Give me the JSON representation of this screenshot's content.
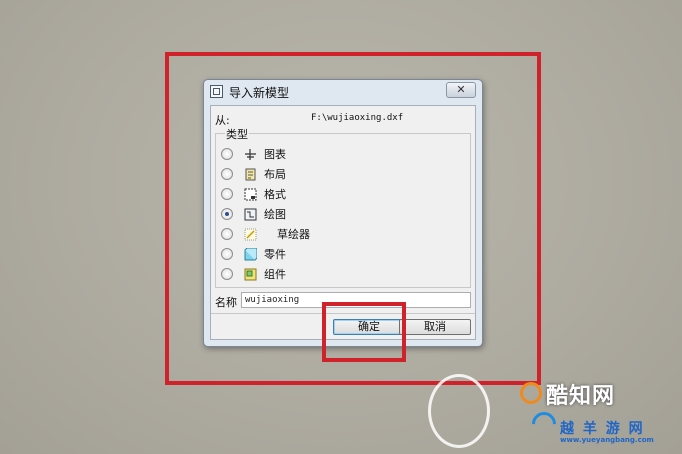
{
  "dialog": {
    "title": "导入新模型",
    "close_label": "✕",
    "from_label": "从:",
    "from_value": "F:\\wujiaoxing.dxf",
    "type_group_label": "类型",
    "types": [
      {
        "label": "图表",
        "icon": "diagram-icon",
        "checked": false
      },
      {
        "label": "布局",
        "icon": "layout-icon",
        "checked": false
      },
      {
        "label": "格式",
        "icon": "format-icon",
        "checked": false
      },
      {
        "label": "绘图",
        "icon": "drawing-icon",
        "checked": true
      },
      {
        "label": "草绘器",
        "icon": "sketcher-icon",
        "checked": false
      },
      {
        "label": "零件",
        "icon": "part-icon",
        "checked": false
      },
      {
        "label": "组件",
        "icon": "assembly-icon",
        "checked": false
      }
    ],
    "name_label": "名称",
    "name_value": "wujiaoxing",
    "ok_label": "确定",
    "cancel_label": "取消"
  },
  "watermark": {
    "brand": "酷知网",
    "sub": "越 羊 游 网",
    "url": "www.yueyangbang.com"
  },
  "colors": {
    "annotation_red": "#d0222a",
    "dialog_frame": "#dfe8f1",
    "watermark_blue": "#1f66c6",
    "watermark_orange": "#f08a1c"
  }
}
